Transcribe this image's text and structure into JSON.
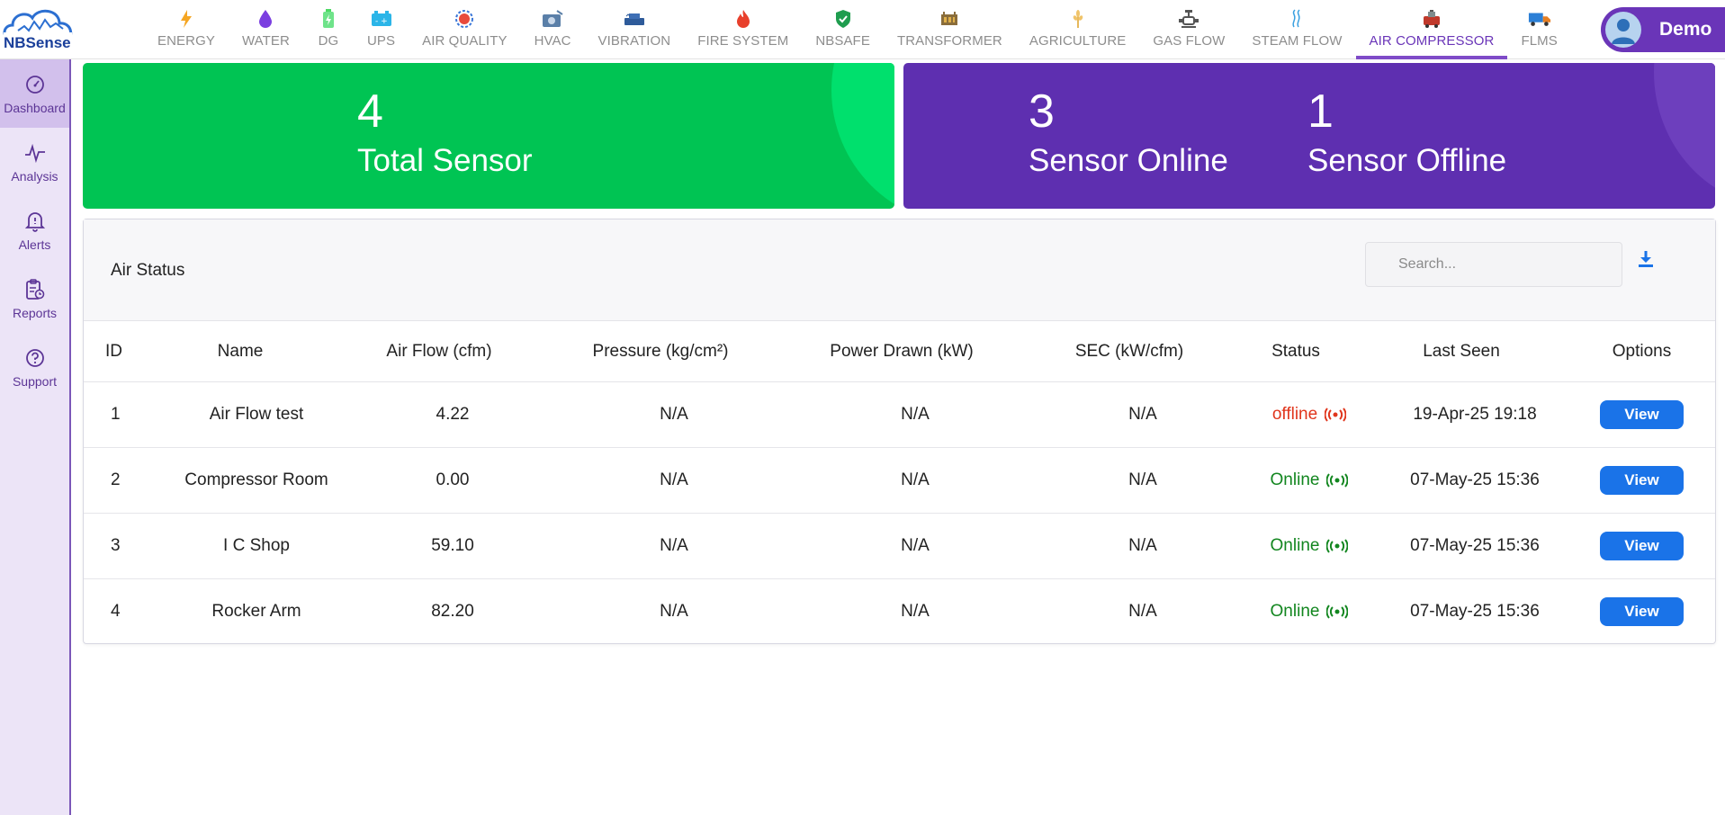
{
  "app": {
    "logo_text": "NBSense"
  },
  "nav": [
    {
      "label": "ENERGY",
      "icon": "lightning-icon"
    },
    {
      "label": "WATER",
      "icon": "water-drop-icon"
    },
    {
      "label": "DG",
      "icon": "battery-icon"
    },
    {
      "label": "UPS",
      "icon": "ups-icon"
    },
    {
      "label": "AIR QUALITY",
      "icon": "air-quality-icon"
    },
    {
      "label": "HVAC",
      "icon": "hvac-icon"
    },
    {
      "label": "VIBRATION",
      "icon": "vibration-icon"
    },
    {
      "label": "FIRE SYSTEM",
      "icon": "fire-icon"
    },
    {
      "label": "NBSAFE",
      "icon": "shield-icon"
    },
    {
      "label": "TRANSFORMER",
      "icon": "transformer-icon"
    },
    {
      "label": "AGRICULTURE",
      "icon": "wheat-icon"
    },
    {
      "label": "GAS FLOW",
      "icon": "gas-valve-icon"
    },
    {
      "label": "STEAM FLOW",
      "icon": "steam-icon"
    },
    {
      "label": "AIR COMPRESSOR",
      "icon": "compressor-icon",
      "active": true
    },
    {
      "label": "FLMS",
      "icon": "truck-icon"
    }
  ],
  "user": {
    "name": "Demo"
  },
  "sidebar": [
    {
      "label": "Dashboard",
      "icon": "gauge-icon",
      "active": true
    },
    {
      "label": "Analysis",
      "icon": "pulse-icon"
    },
    {
      "label": "Alerts",
      "icon": "bell-icon"
    },
    {
      "label": "Reports",
      "icon": "clipboard-icon"
    },
    {
      "label": "Support",
      "icon": "help-icon"
    }
  ],
  "stats": {
    "total": {
      "value": "4",
      "label": "Total Sensor"
    },
    "online": {
      "value": "3",
      "label": "Sensor Online"
    },
    "offline": {
      "value": "1",
      "label": "Sensor Offline"
    }
  },
  "colors": {
    "green": "#00c453",
    "purple": "#5e2fb0",
    "offline": "#e0351c",
    "online": "#12861f",
    "button": "#1a73e8"
  },
  "panel": {
    "title": "Air Status",
    "search_placeholder": "Search...",
    "columns": [
      "ID",
      "Name",
      "Air Flow (cfm)",
      "Pressure (kg/cm²)",
      "Power Drawn (kW)",
      "SEC (kW/cfm)",
      "Status",
      "Last Seen",
      "Options"
    ],
    "rows": [
      {
        "id": "1",
        "name": "Air Flow test",
        "airflow": "4.22",
        "pressure": "N/A",
        "power": "N/A",
        "sec": "N/A",
        "status": "offline",
        "last_seen": "19-Apr-25 19:18",
        "option": "View"
      },
      {
        "id": "2",
        "name": "Compressor Room",
        "airflow": "0.00",
        "pressure": "N/A",
        "power": "N/A",
        "sec": "N/A",
        "status": "Online",
        "last_seen": "07-May-25 15:36",
        "option": "View"
      },
      {
        "id": "3",
        "name": "I C Shop",
        "airflow": "59.10",
        "pressure": "N/A",
        "power": "N/A",
        "sec": "N/A",
        "status": "Online",
        "last_seen": "07-May-25 15:36",
        "option": "View"
      },
      {
        "id": "4",
        "name": "Rocker Arm",
        "airflow": "82.20",
        "pressure": "N/A",
        "power": "N/A",
        "sec": "N/A",
        "status": "Online",
        "last_seen": "07-May-25 15:36",
        "option": "View"
      }
    ]
  }
}
